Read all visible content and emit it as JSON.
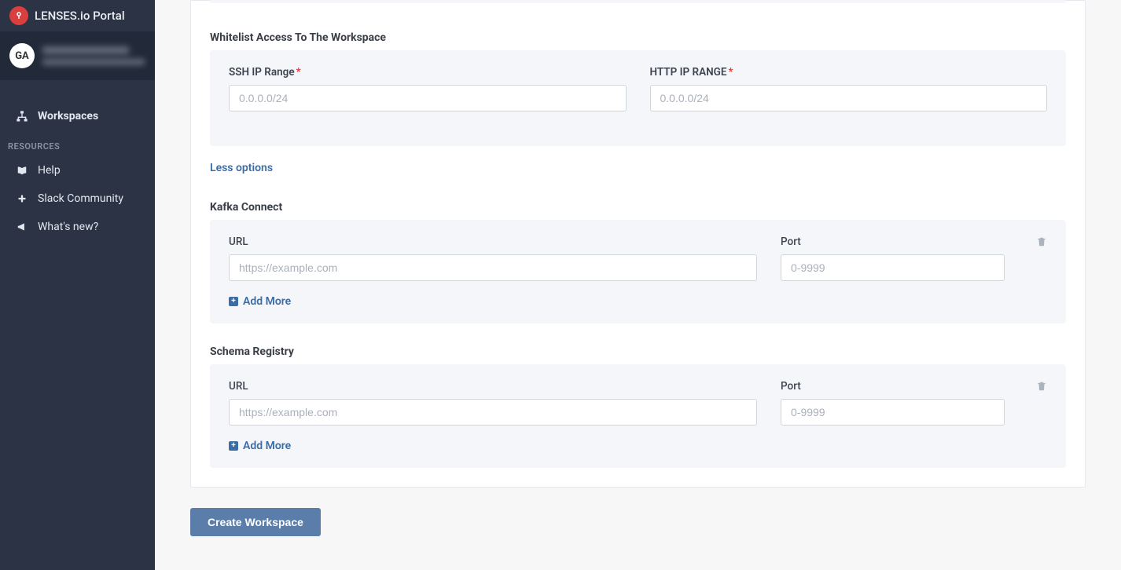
{
  "brand": {
    "title": "LENSES.io Portal"
  },
  "user": {
    "initials": "GA"
  },
  "nav": {
    "workspaces": "Workspaces",
    "resources_header": "RESOURCES",
    "help": "Help",
    "slack": "Slack Community",
    "whatsnew": "What's new?"
  },
  "form": {
    "whitelist": {
      "title": "Whitelist Access To The Workspace",
      "ssh_label": "SSH IP Range",
      "ssh_placeholder": "0.0.0.0/24",
      "http_label": "HTTP IP RANGE",
      "http_placeholder": "0.0.0.0/24"
    },
    "less_options": "Less options",
    "kafka": {
      "title": "Kafka Connect",
      "url_label": "URL",
      "url_placeholder": "https://example.com",
      "port_label": "Port",
      "port_placeholder": "0-9999",
      "add_more": "Add More"
    },
    "schema": {
      "title": "Schema Registry",
      "url_label": "URL",
      "url_placeholder": "https://example.com",
      "port_label": "Port",
      "port_placeholder": "0-9999",
      "add_more": "Add More"
    },
    "submit": "Create Workspace"
  }
}
